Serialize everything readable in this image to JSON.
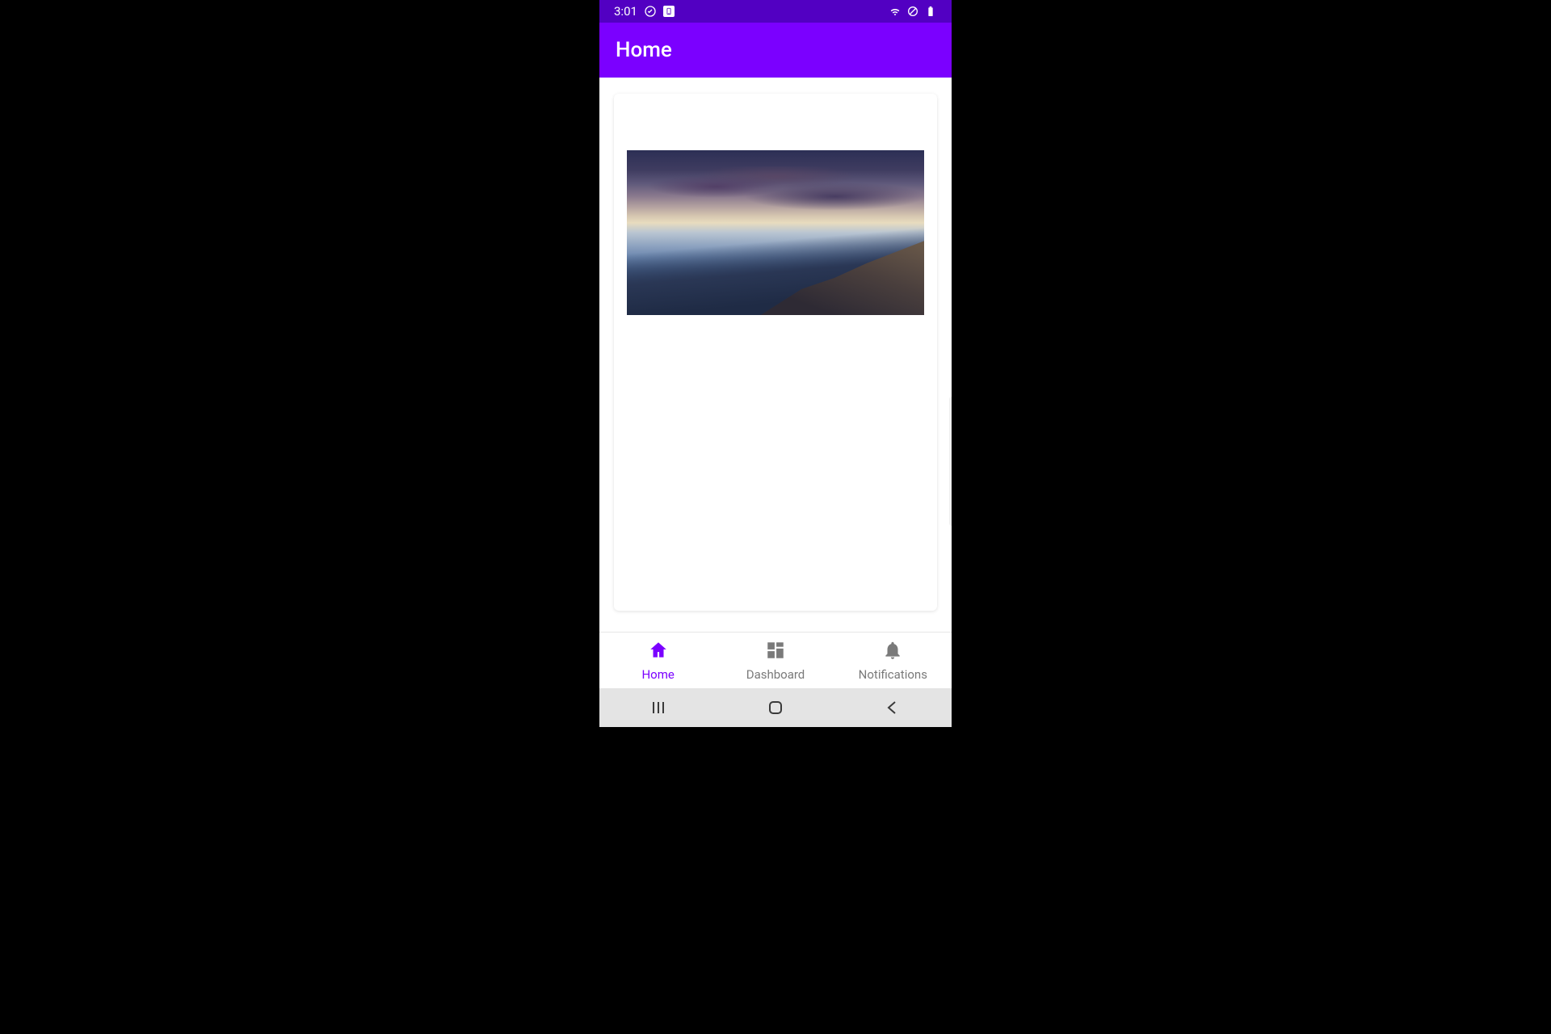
{
  "status": {
    "time": "3:01"
  },
  "appbar": {
    "title": "Home"
  },
  "bottomnav": {
    "items": [
      {
        "label": "Home",
        "active": true
      },
      {
        "label": "Dashboard",
        "active": false
      },
      {
        "label": "Notifications",
        "active": false
      }
    ]
  }
}
